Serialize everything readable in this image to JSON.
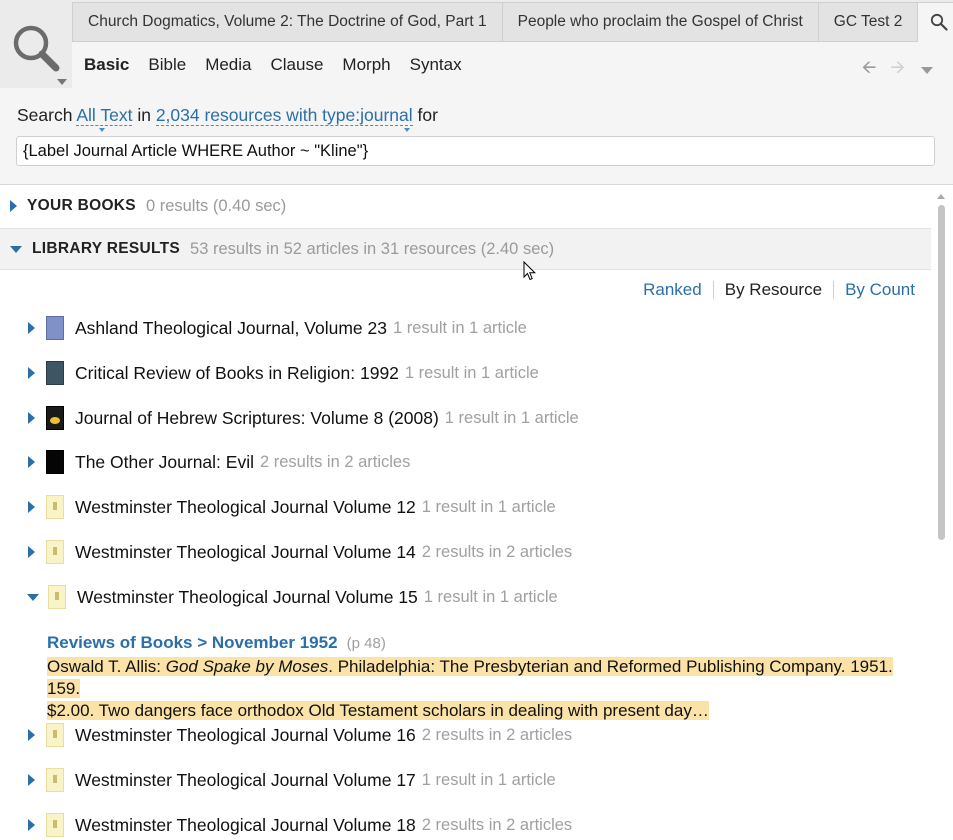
{
  "tabs": [
    {
      "label": "Church Dogmatics, Volume 2: The Doctrine of God, Part 1"
    },
    {
      "label": "People who proclaim the Gospel of Christ"
    },
    {
      "label": "GC Test 2"
    }
  ],
  "active_tab": {
    "icon": "search-icon",
    "close": "×"
  },
  "add_tab": "+",
  "modes": [
    "Basic",
    "Bible",
    "Media",
    "Clause",
    "Morph",
    "Syntax"
  ],
  "search": {
    "prefix": "Search",
    "scope": "All Text",
    "in": "in",
    "collection": "2,034 resources with type:journal",
    "for": "for",
    "query": "{Label Journal Article WHERE Author ~ \"Kline\"}"
  },
  "sections": {
    "your_books": {
      "title": "YOUR BOOKS",
      "meta": "0 results (0.40 sec)"
    },
    "library": {
      "title": "LIBRARY RESULTS",
      "meta": "53 results in 52 articles in 31 resources (2.40 sec)"
    }
  },
  "sort": {
    "ranked": "Ranked",
    "by_resource": "By Resource",
    "by_count": "By Count"
  },
  "results": [
    {
      "title": "Ashland Theological Journal, Volume 23",
      "count": "1 result in 1 article"
    },
    {
      "title": "Critical Review of Books in Religion: 1992",
      "count": "1 result in 1 article"
    },
    {
      "title": "Journal of Hebrew Scriptures: Volume 8 (2008)",
      "count": "1 result in 1 article"
    },
    {
      "title": "The Other Journal: Evil",
      "count": "2 results in 2 articles"
    },
    {
      "title": "Westminster Theological Journal Volume 12",
      "count": "1 result in 1 article"
    },
    {
      "title": "Westminster Theological Journal Volume 14",
      "count": "2 results in 2 articles"
    },
    {
      "title": "Westminster Theological Journal Volume 15",
      "count": "1 result in 1 article"
    },
    {
      "title": "Westminster Theological Journal Volume 16",
      "count": "2 results in 2 articles"
    },
    {
      "title": "Westminster Theological Journal Volume 17",
      "count": "1 result in 1 article"
    },
    {
      "title": "Westminster Theological Journal Volume 18",
      "count": "2 results in 2 articles"
    }
  ],
  "snippet": {
    "link": "Reviews of Books > November 1952",
    "page": "(p 48)",
    "author": "Oswald T. Allis: ",
    "work": "God Spake by Moses",
    "line1_rest": ". Philadelphia: The Presbyterian and Reformed Publishing Company. 1951. 159.",
    "line2": "$2.00. Two dangers face orthodox Old Testament scholars in dealing with present day…"
  },
  "colors": {
    "link": "#2a6fa8",
    "highlight": "#fbe3a8",
    "chrome": "#ebebeb"
  }
}
